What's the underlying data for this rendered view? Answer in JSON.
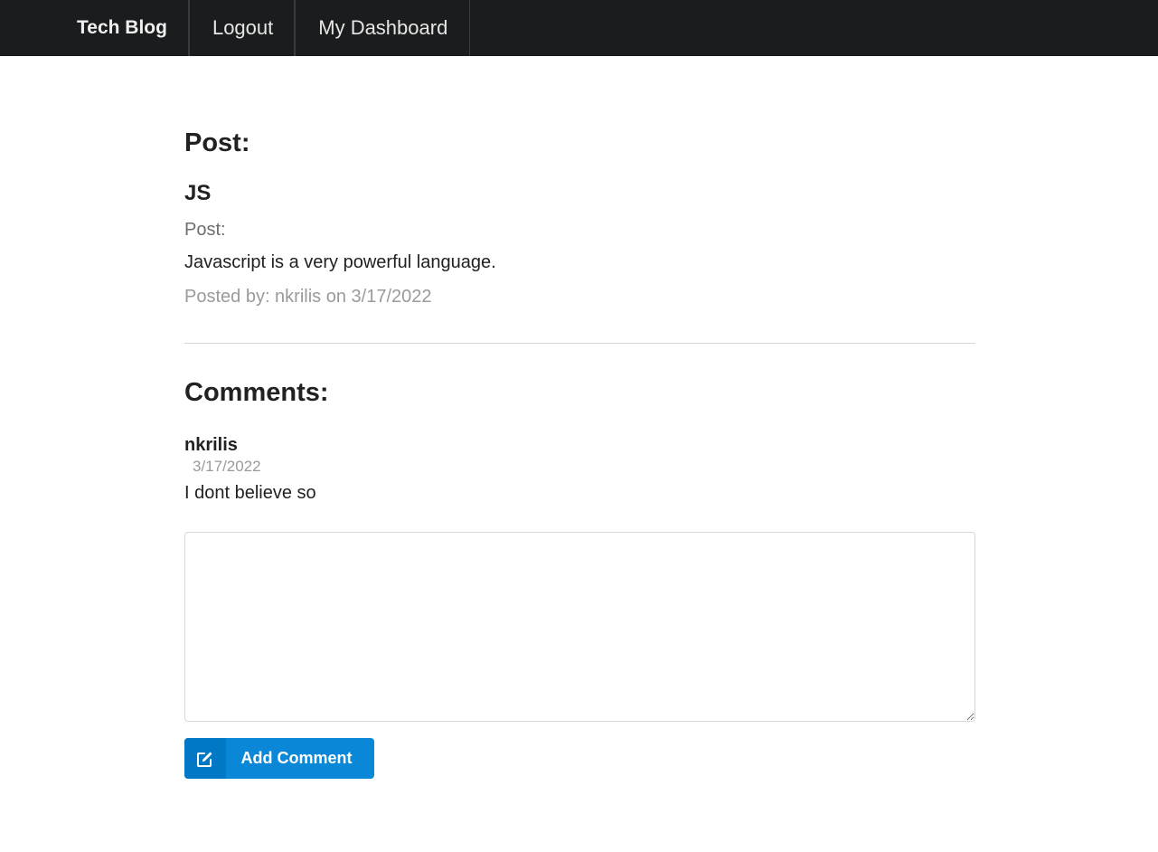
{
  "nav": {
    "brand": "Tech Blog",
    "logout": "Logout",
    "dashboard": "My Dashboard"
  },
  "post": {
    "heading": "Post:",
    "title": "JS",
    "label": "Post:",
    "body": "Javascript is a very powerful language.",
    "meta": "Posted by: nkrilis on 3/17/2022"
  },
  "comments": {
    "heading": "Comments:",
    "items": [
      {
        "author": "nkrilis",
        "date": "3/17/2022",
        "text": "I dont believe so"
      }
    ],
    "form": {
      "textarea_value": "",
      "button_label": "Add Comment",
      "button_icon": "edit-icon"
    }
  },
  "colors": {
    "topbar": "#1b1c1d",
    "button": "#0a87d6",
    "button_icon_bg": "#0078c5"
  }
}
